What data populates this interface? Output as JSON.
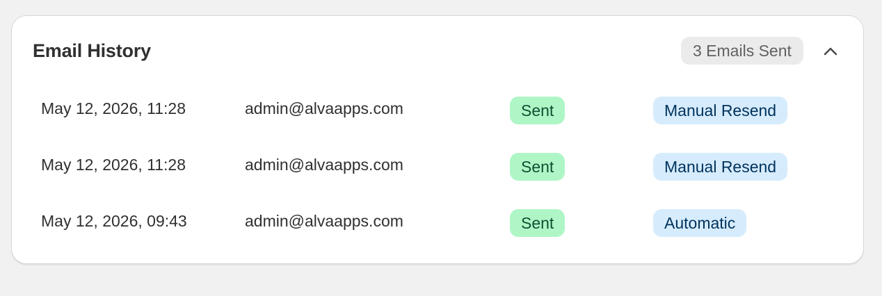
{
  "email_history": {
    "title": "Email History",
    "count_label": "3 Emails Sent",
    "collapse_icon": "chevron-up-icon",
    "rows": [
      {
        "date": "May 12, 2026, 11:28",
        "recipient": "admin@alvaapps.com",
        "status": "Sent",
        "type": "Manual Resend"
      },
      {
        "date": "May 12, 2026, 11:28",
        "recipient": "admin@alvaapps.com",
        "status": "Sent",
        "type": "Manual Resend"
      },
      {
        "date": "May 12, 2026, 09:43",
        "recipient": "admin@alvaapps.com",
        "status": "Sent",
        "type": "Automatic"
      }
    ]
  },
  "colors": {
    "status_bg": "#aff6c7",
    "status_text": "#0c5132",
    "type_bg": "#d6ecfd",
    "type_text": "#00325c"
  }
}
